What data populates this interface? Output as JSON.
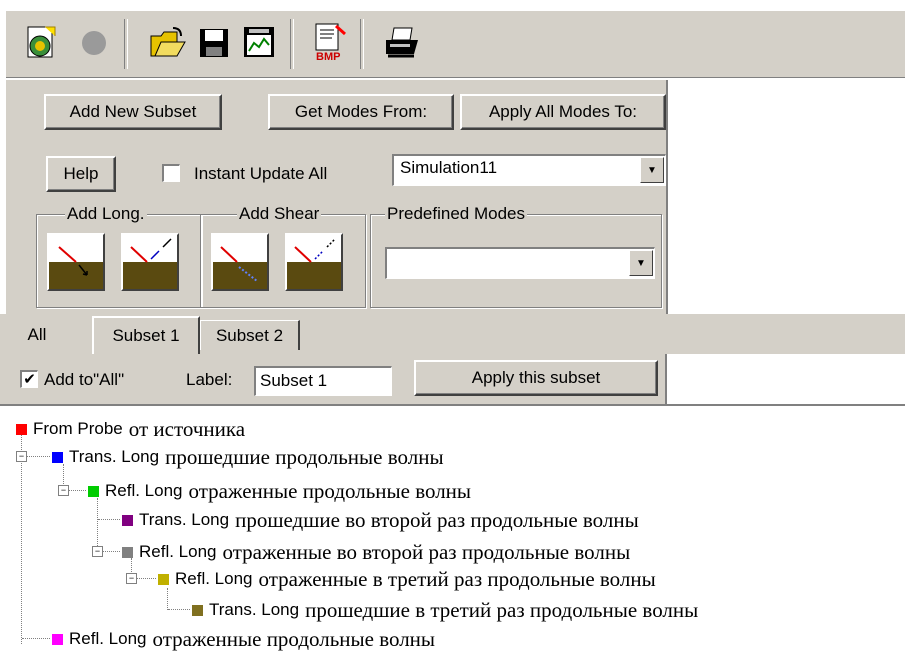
{
  "toolbar": {
    "icons": [
      "new-simulation-icon",
      "record-icon",
      "open-folder-icon",
      "save-icon",
      "export-chart-icon",
      "export-bmp-icon",
      "print-icon"
    ],
    "bmp_label": "BMP"
  },
  "panel": {
    "add_new_subset": "Add New Subset",
    "get_modes_from": "Get Modes From:",
    "apply_all_modes_to": "Apply All Modes To:",
    "help": "Help",
    "instant_update_all": "Instant Update All",
    "instant_update_checked": false,
    "simulation_selected": "Simulation11",
    "group_add_long": "Add Long.",
    "group_add_shear": "Add Shear",
    "group_predefined": "Predefined Modes",
    "predefined_selected": ""
  },
  "tabs": [
    {
      "label": "All",
      "active": false
    },
    {
      "label": "Subset 1",
      "active": true
    },
    {
      "label": "Subset 2",
      "active": false
    }
  ],
  "subset": {
    "add_to_all_label": "Add to\"All\"",
    "add_to_all_checked": true,
    "label_caption": "Label:",
    "label_value": "Subset 1",
    "apply_button": "Apply this subset"
  },
  "tree": [
    {
      "label": "From Probe",
      "ru": "от источника",
      "color": "#ff0000"
    },
    {
      "label": "Trans. Long",
      "ru": "прошедшие продольные волны",
      "color": "#0000ff"
    },
    {
      "label": "Refl. Long",
      "ru": "отраженные продольные волны",
      "color": "#00cc00"
    },
    {
      "label": "Trans. Long",
      "ru": "прошедшие во второй раз продольные волны",
      "color": "#800080"
    },
    {
      "label": "Refl. Long",
      "ru": "отраженные во второй раз продольные волны",
      "color": "#808080"
    },
    {
      "label": "Refl. Long",
      "ru": "отраженные в третий раз продольные волны",
      "color": "#c0b000"
    },
    {
      "label": "Trans. Long",
      "ru": "прошедшие в третий раз продольные волны",
      "color": "#807020"
    },
    {
      "label": "Refl. Long",
      "ru": "отраженные продольные волны",
      "color": "#ff00ff"
    }
  ]
}
